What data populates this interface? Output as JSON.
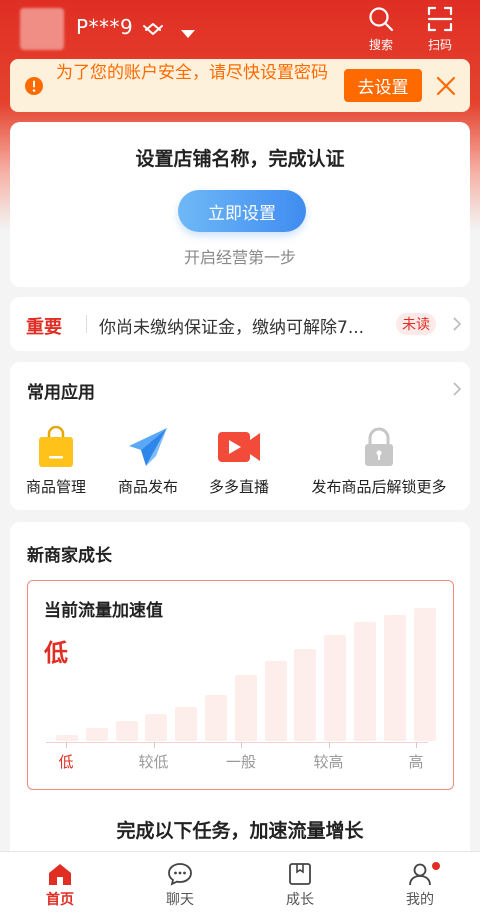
{
  "header": {
    "user_name": "P***9",
    "search_label": "搜索",
    "scan_label": "扫码"
  },
  "security_banner": {
    "text": "为了您的账户安全，请尽快设置密码",
    "action_label": "去设置"
  },
  "setup_card": {
    "title": "设置店铺名称，完成认证",
    "button_label": "立即设置",
    "subtitle": "开启经营第一步"
  },
  "notice": {
    "tag": "重要",
    "text": "你尚未缴纳保证金，缴纳可解除7...",
    "badge": "未读"
  },
  "apps": {
    "title": "常用应用",
    "items": [
      {
        "label": "商品管理",
        "icon": "shopping-bag-icon"
      },
      {
        "label": "商品发布",
        "icon": "paper-plane-icon"
      },
      {
        "label": "多多直播",
        "icon": "live-video-icon"
      },
      {
        "label": "发布商品后解锁更多",
        "icon": "lock-icon"
      }
    ]
  },
  "growth": {
    "title": "新商家成长",
    "flow_title": "当前流量加速值",
    "flow_level": "低",
    "ticks": [
      "低",
      "较低",
      "一般",
      "较高",
      "高"
    ],
    "active_tick": 0,
    "bar_levels": [
      0.04,
      0.09,
      0.14,
      0.19,
      0.24,
      0.33,
      0.47,
      0.57,
      0.66,
      0.76,
      0.85,
      0.9,
      0.95
    ],
    "tasks_title": "完成以下任务，加速流量增长"
  },
  "tabbar": {
    "tabs": [
      {
        "label": "首页",
        "active": true
      },
      {
        "label": "聊天",
        "active": false
      },
      {
        "label": "成长",
        "active": false
      },
      {
        "label": "我的",
        "active": false,
        "badge_dot": true
      }
    ]
  },
  "colors": {
    "brand_red": "#e02e24",
    "warning_orange": "#ff6a00",
    "banner_bg": "#fdf1db",
    "primary_blue": "#3f8cf0"
  }
}
